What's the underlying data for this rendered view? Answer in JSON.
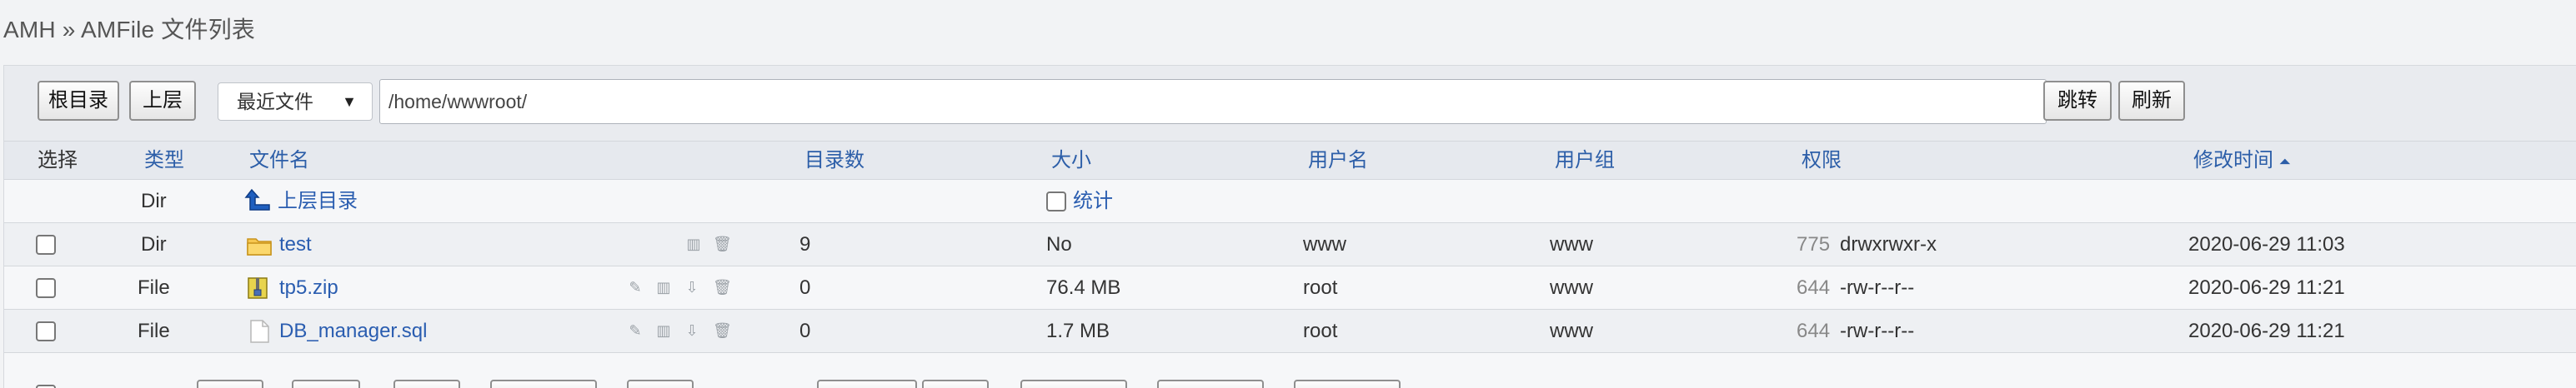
{
  "breadcrumb": "AMH » AMFile 文件列表",
  "toolbar": {
    "root_label": "根目录",
    "up_label": "上层",
    "recent_label": "最近文件",
    "path_value": "/home/wwwroot/",
    "jump_label": "跳转",
    "refresh_label": "刷新"
  },
  "table": {
    "headers": {
      "select": "选择",
      "type": "类型",
      "name": "文件名",
      "dir_count": "目录数",
      "size": "大小",
      "user": "用户名",
      "group": "用户组",
      "perm": "权限",
      "mtime": "修改时间"
    },
    "sort_icon": "sort-asc-icon",
    "parent_row": {
      "type": "Dir",
      "name": "上层目录",
      "stats_label": "统计"
    },
    "rows": [
      {
        "type": "Dir",
        "name": "test",
        "dir_count": "9",
        "size": "No",
        "user": "www",
        "group": "www",
        "perm_num": "775",
        "perm_str": "drwxrwxr-x",
        "mtime": "2020-06-29 11:03",
        "icon": "folder-icon"
      },
      {
        "type": "File",
        "name": "tp5.zip",
        "dir_count": "0",
        "size": "76.4 MB",
        "user": "root",
        "group": "www",
        "perm_num": "644",
        "perm_str": "-rw-r--r--",
        "mtime": "2020-06-29 11:21",
        "icon": "zip-file-icon"
      },
      {
        "type": "File",
        "name": "DB_manager.sql",
        "dir_count": "0",
        "size": "1.7 MB",
        "user": "root",
        "group": "www",
        "perm_num": "644",
        "perm_str": "-rw-r--r--",
        "mtime": "2020-06-29 11:21",
        "icon": "document-file-icon"
      }
    ]
  },
  "colors": {
    "link": "#2a5db0",
    "panel": "#e9ebef"
  }
}
